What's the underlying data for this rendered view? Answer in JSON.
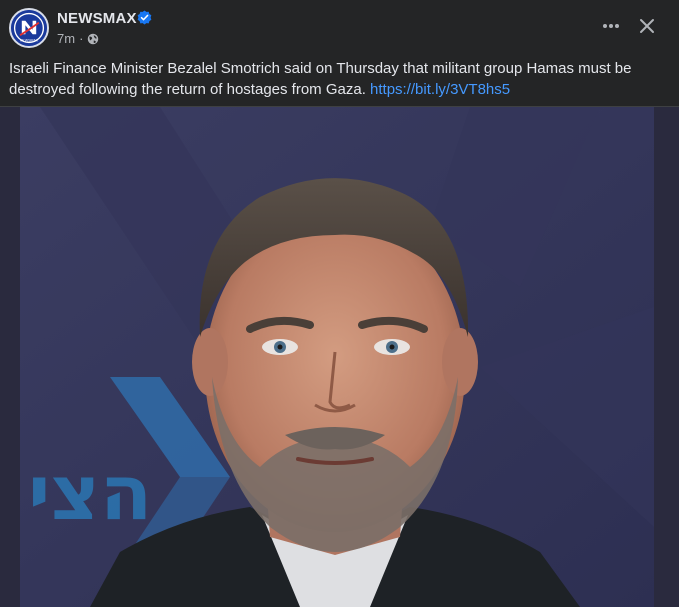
{
  "post": {
    "page_name": "NEWSMAX",
    "time": "7m",
    "separator": "·",
    "caption_text": "Israeli Finance Minister Bezalel Smotrich said on Thursday that militant group Hamas must be destroyed following the return of hostages from Gaza.",
    "link_text": "https://bit.ly/3VT8hs5",
    "avatar_text": "NEWSMAX",
    "background_text": "הצי"
  },
  "icons": {
    "avatar": "newsmax-logo",
    "verified": "verified-badge-icon",
    "audience": "globe-icon",
    "more": "more-options-icon",
    "close": "close-icon"
  },
  "colors": {
    "background": "#242526",
    "text": "#e4e6eb",
    "secondary_text": "#b0b3b8",
    "link": "#4599ff",
    "verified": "#1877f2"
  }
}
